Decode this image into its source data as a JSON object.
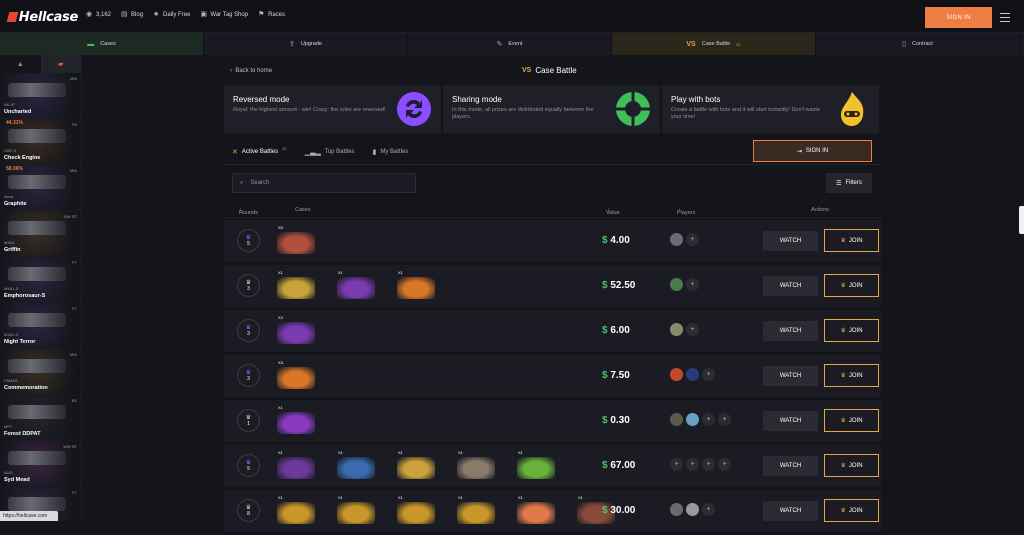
{
  "header": {
    "logo": "Hellcase",
    "online_count": "3,162",
    "nav": [
      {
        "label": "Blog",
        "icon": "blog-icon"
      },
      {
        "label": "Daily Free",
        "icon": "star-icon"
      },
      {
        "label": "War Tag Shop",
        "icon": "shop-icon"
      },
      {
        "label": "Races",
        "icon": "flag-icon"
      }
    ],
    "signin_label": "SIGN IN"
  },
  "tabs": [
    {
      "label": "Cases",
      "icon": "cases-icon"
    },
    {
      "label": "Upgrade",
      "icon": "upgrade-icon"
    },
    {
      "label": "Event",
      "icon": "event-icon"
    },
    {
      "label": "Case Battle",
      "icon": "vs-icon",
      "badge": "21"
    },
    {
      "label": "Contract",
      "icon": "contract-icon"
    }
  ],
  "live_feed": [
    {
      "weapon": "AK-47",
      "skin": "Uncharted",
      "condition": "MW",
      "color": "#2a2540"
    },
    {
      "weapon": "USP-S",
      "skin": "Check Engine",
      "condition": "FN",
      "pct": "44.31%",
      "color": "#3a2a20"
    },
    {
      "weapon": "Nova",
      "skin": "Graphite",
      "condition": "MW",
      "pct": "58.06%",
      "color": "#2a2540"
    },
    {
      "weapon": "M4A4",
      "skin": "Griffin",
      "condition": "BW",
      "stattrak": "ST",
      "color": "#3a3024"
    },
    {
      "weapon": "M4A1-S",
      "skin": "Emphorosaur-S",
      "condition": "FT",
      "color": "#2a2540"
    },
    {
      "weapon": "M4A1-S",
      "skin": "Night Terror",
      "condition": "FT",
      "color": "#2a2540"
    },
    {
      "weapon": "FAMAS",
      "skin": "Commemoration",
      "condition": "MW",
      "color": "#3a3024"
    },
    {
      "weapon": "MP7",
      "skin": "Forest DDPAT",
      "condition": "BS",
      "color": "#24252d"
    },
    {
      "weapon": "AUG",
      "skin": "Syd Mead",
      "condition": "WW",
      "stattrak": "ST",
      "color": "#3a2440"
    },
    {
      "weapon": "",
      "skin": "",
      "condition": "FT",
      "color": "#2a2540"
    }
  ],
  "status_url": "https://hellcase.com",
  "page": {
    "back_label": "Back to home",
    "title": "Case Battle",
    "modes": [
      {
        "title": "Reversed mode",
        "desc": "Royal: the highest amount - win! Crazy: the rules are reversed!"
      },
      {
        "title": "Sharing mode",
        "desc": "In this mode, all prizes are distributed equally between the players."
      },
      {
        "title": "Play with bots",
        "desc": "Create a battle with bots and it will start instantly! Don't waste your time!"
      }
    ],
    "subtabs": [
      {
        "label": "Active Battles",
        "badge": "21"
      },
      {
        "label": "Top Battles"
      },
      {
        "label": "My Battles"
      }
    ],
    "signin_label": "SIGN IN",
    "search_placeholder": "Search",
    "filters_label": "Filters",
    "columns": {
      "rounds": "Rounds",
      "cases": "Cases",
      "value": "Value",
      "players": "Players",
      "actions": "Actions"
    },
    "watch_label": "WATCH",
    "join_label": "JOIN"
  },
  "battles": [
    {
      "rounds": "5",
      "crown": "#8a6cff",
      "cases": [
        {
          "qty": "X5",
          "color": "#b0503a"
        }
      ],
      "value": "4.00",
      "players": [
        {
          "c": "#6a6a7a"
        },
        {
          "empty": true
        }
      ]
    },
    {
      "rounds": "3",
      "crown": "#d8d9de",
      "cases": [
        {
          "qty": "X1",
          "color": "#c9a23a"
        },
        {
          "qty": "X1",
          "color": "#7a3ab0"
        },
        {
          "qty": "X1",
          "color": "#d8762a"
        }
      ],
      "value": "52.50",
      "players": [
        {
          "c": "#4a7a4a"
        },
        {
          "empty": true
        }
      ]
    },
    {
      "rounds": "3",
      "crown": "#8a6cff",
      "cases": [
        {
          "qty": "X3",
          "color": "#7a3ab0"
        }
      ],
      "value": "6.00",
      "players": [
        {
          "c": "#8a8a6a"
        },
        {
          "empty": true
        }
      ]
    },
    {
      "rounds": "3",
      "crown": "#8a6cff",
      "cases": [
        {
          "qty": "X3",
          "color": "#d8762a"
        }
      ],
      "value": "7.50",
      "players": [
        {
          "c": "#c04a2a"
        },
        {
          "c": "#2a3a7a"
        },
        {
          "empty": true
        }
      ]
    },
    {
      "rounds": "1",
      "crown": "#d8d9de",
      "cases": [
        {
          "qty": "X1",
          "color": "#8a3ac0"
        }
      ],
      "value": "0.30",
      "players": [
        {
          "c": "#5a5a4a"
        },
        {
          "c": "#6aa0c0"
        },
        {
          "empty": true
        },
        {
          "empty": true
        }
      ]
    },
    {
      "rounds": "5",
      "crown": "#8a6cff",
      "cases": [
        {
          "qty": "X1",
          "color": "#6a3a9a"
        },
        {
          "qty": "X1",
          "color": "#3a6ab0"
        },
        {
          "qty": "X1",
          "color": "#c9a23a"
        },
        {
          "qty": "X1",
          "color": "#8a7a6a"
        },
        {
          "qty": "X1",
          "color": "#6ab03a"
        }
      ],
      "value": "67.00",
      "players": [
        {
          "empty": true
        },
        {
          "empty": true
        },
        {
          "empty": true
        },
        {
          "empty": true
        }
      ]
    },
    {
      "rounds": "8",
      "crown": "#d8d9de",
      "cases": [
        {
          "qty": "X1",
          "color": "#c9962a"
        },
        {
          "qty": "X1",
          "color": "#c9962a"
        },
        {
          "qty": "X1",
          "color": "#c9962a"
        },
        {
          "qty": "X1",
          "color": "#c9962a"
        },
        {
          "qty": "X1",
          "color": "#e0784a"
        },
        {
          "qty": "X1",
          "color": "#8a4a3a"
        }
      ],
      "value": "30.00",
      "players": [
        {
          "c": "#6a6a6a"
        },
        {
          "c": "#9a9a9a"
        },
        {
          "empty": true
        }
      ]
    }
  ],
  "colors": {
    "accent": "#ee7d43",
    "gold": "#e3a74a",
    "green": "#4cc36b"
  }
}
